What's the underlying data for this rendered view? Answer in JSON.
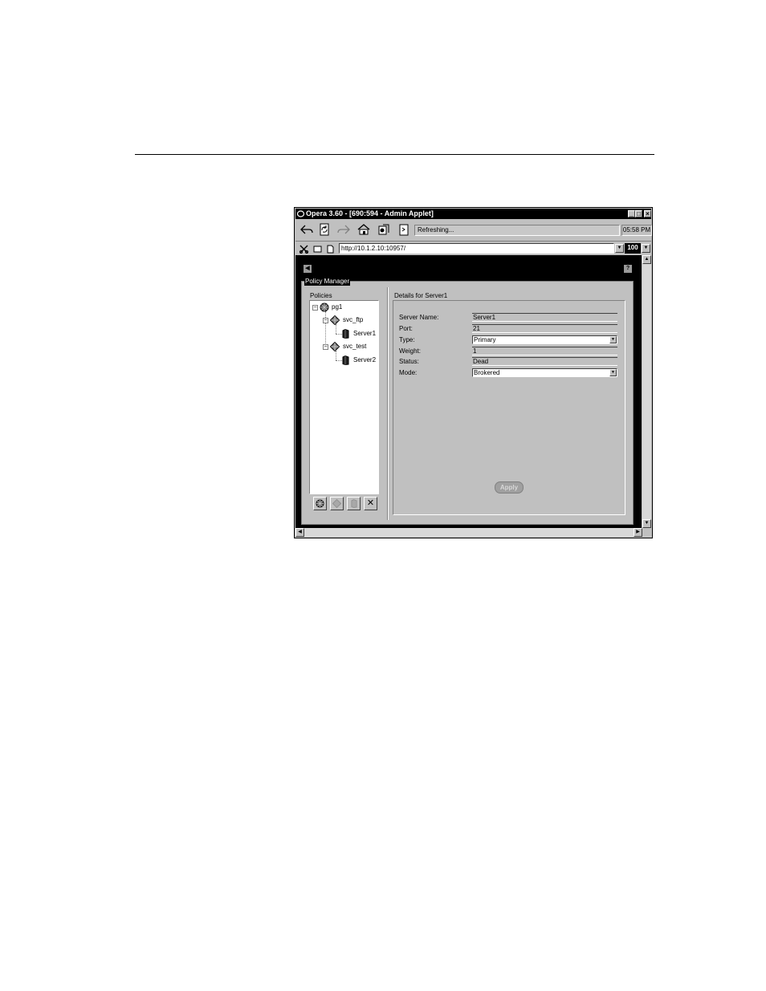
{
  "window": {
    "title": "Opera 3.60 - [690:594 - Admin Applet]",
    "minimize_label": "_",
    "maximize_label": "□",
    "close_label": "×"
  },
  "toolbar": {
    "status_text": "Refreshing...",
    "clock": "05:58 PM"
  },
  "address": {
    "url": "http://10.1.2.10:10957/",
    "zoom": "100"
  },
  "applet": {
    "help_label": "?",
    "back_label": "◀",
    "group_title": "Policy Manager",
    "policies_label": "Policies",
    "tree": [
      {
        "label": "pg1"
      },
      {
        "label": "svc_ftp"
      },
      {
        "label": "Server1"
      },
      {
        "label": "svc_test"
      },
      {
        "label": "Server2"
      }
    ],
    "delete_label": "✕",
    "details_title": "Details for Server1",
    "fields": {
      "server_name": {
        "label": "Server Name:",
        "value": "Server1"
      },
      "port": {
        "label": "Port:",
        "value": "21"
      },
      "type": {
        "label": "Type:",
        "value": "Primary"
      },
      "weight": {
        "label": "Weight:",
        "value": "1"
      },
      "status": {
        "label": "Status:",
        "value": "Dead"
      },
      "mode": {
        "label": "Mode:",
        "value": "Brokered"
      }
    },
    "apply_label": "Apply"
  },
  "colors": {
    "applet_background": "#000000",
    "window_chrome": "#c0c0c0"
  }
}
